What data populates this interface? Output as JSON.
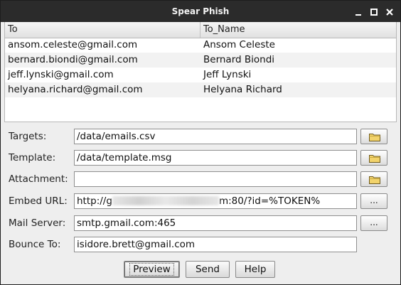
{
  "window": {
    "title": "Spear Phish"
  },
  "table": {
    "columns": [
      "To",
      "To_Name"
    ],
    "rows": [
      {
        "to": "ansom.celeste@gmail.com",
        "to_name": "Ansom Celeste"
      },
      {
        "to": "bernard.biondi@gmail.com",
        "to_name": "Bernard Biondi"
      },
      {
        "to": "jeff.lynski@gmail.com",
        "to_name": "Jeff Lynski"
      },
      {
        "to": "helyana.richard@gmail.com",
        "to_name": "Helyana Richard"
      }
    ]
  },
  "form": {
    "targets": {
      "label": "Targets:",
      "value": "/data/emails.csv"
    },
    "template": {
      "label": "Template:",
      "value": "/data/template.msg"
    },
    "attachment": {
      "label": "Attachment:",
      "value": ""
    },
    "embed_url": {
      "label": "Embed URL:",
      "value_prefix": "http://g",
      "value_suffix": "m:80/?id=%TOKEN%"
    },
    "mail_server": {
      "label": "Mail Server:",
      "value": "smtp.gmail.com:465"
    },
    "bounce_to": {
      "label": "Bounce To:",
      "value": "isidore.brett@gmail.com"
    },
    "ellipsis_label": "..."
  },
  "buttons": {
    "preview": "Preview",
    "send": "Send",
    "help": "Help"
  },
  "icons": {
    "browse": "folder-icon",
    "minimize": "minimize-icon",
    "maximize": "maximize-icon",
    "close": "close-icon"
  },
  "colors": {
    "titlebar": "#2b2b2b",
    "folder": "#f2d36b"
  }
}
